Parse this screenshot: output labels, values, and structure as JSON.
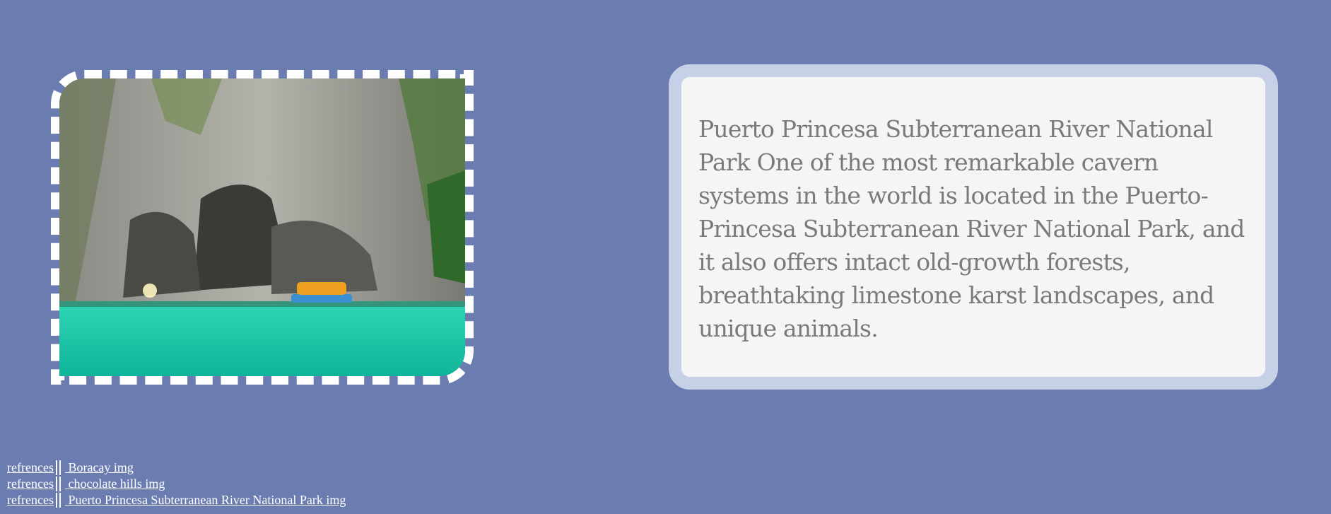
{
  "colors": {
    "background": "#6b7db0",
    "card_border": "#c6d0e6",
    "card_background": "#f5f5f5",
    "card_text": "#7a7a7a",
    "frame_border": "#ffffff"
  },
  "image": {
    "subject": "cave-lagoon-boat"
  },
  "info": {
    "text": "Puerto Princesa Subterranean River National Park One of the most remarkable cavern systems in the world is located in the Puerto-Princesa Subterranean River National Park, and it also offers intact old-growth forests, breathtaking limestone karst landscapes, and unique animals."
  },
  "references": [
    {
      "label": "refrences",
      "link": " Boracay img"
    },
    {
      "label": "refrences",
      "link": " chocolate hills img"
    },
    {
      "label": "refrences",
      "link": " Puerto Princesa Subterranean River National Park img"
    }
  ]
}
